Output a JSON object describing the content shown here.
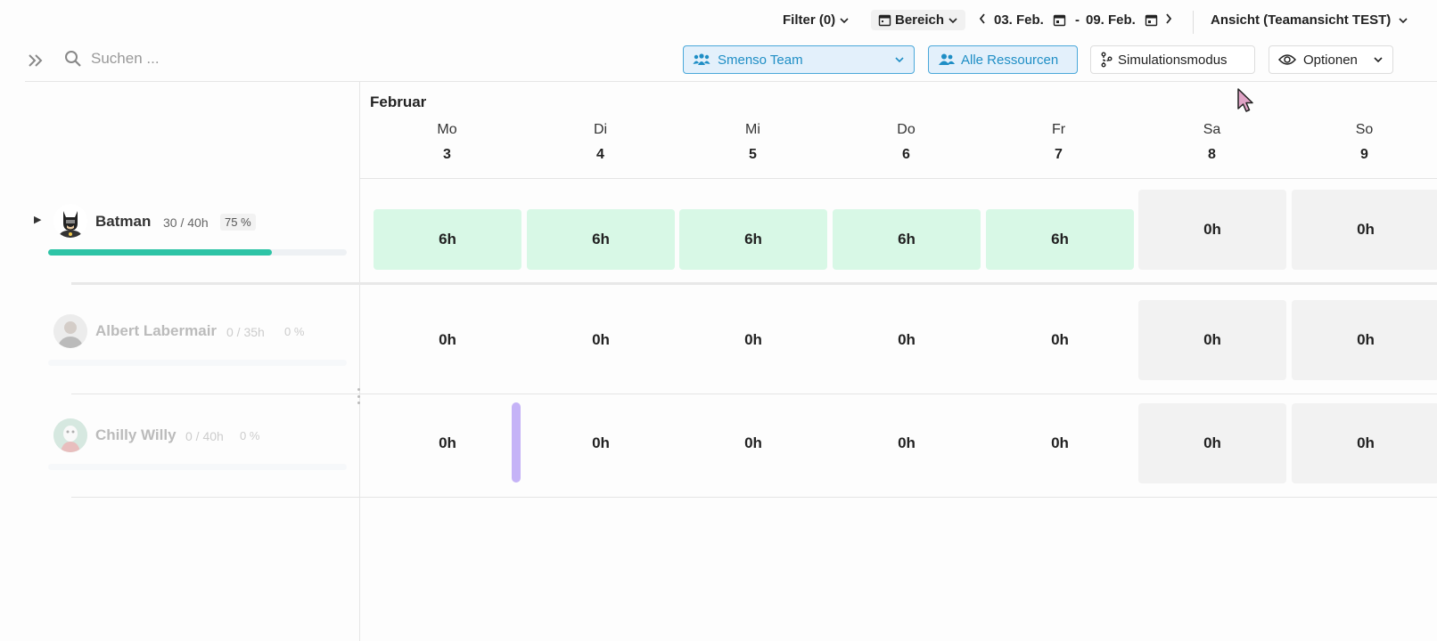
{
  "topbar": {
    "filter_label": "Filter (0)",
    "range_label": "Bereich",
    "date_from": "03. Feb.",
    "date_sep": "-",
    "date_to": "09. Feb.",
    "view_prefix": "Ansicht (",
    "view_name": "Teamansicht TEST",
    "view_suffix": ")"
  },
  "toolbar": {
    "search_placeholder": "Suchen ...",
    "team_select_value": "Smenso Team",
    "all_resources_label": "Alle Ressourcen",
    "simulation_label": "Simulationsmodus",
    "options_label": "Optionen"
  },
  "calendar": {
    "month": "Februar",
    "days": [
      {
        "name": "Mo",
        "date": "3"
      },
      {
        "name": "Di",
        "date": "4"
      },
      {
        "name": "Mi",
        "date": "5"
      },
      {
        "name": "Do",
        "date": "6"
      },
      {
        "name": "Fr",
        "date": "7"
      },
      {
        "name": "Sa",
        "date": "8"
      },
      {
        "name": "So",
        "date": "9"
      }
    ]
  },
  "resources": [
    {
      "name": "Batman",
      "hours": "30 / 40h",
      "percent": "75 %",
      "utilization": 0.75,
      "cells": [
        "6h",
        "6h",
        "6h",
        "6h",
        "6h",
        "0h",
        "0h"
      ]
    },
    {
      "name": "Albert Labermair",
      "hours": "0 / 35h",
      "percent": "0 %",
      "utilization": 0,
      "cells": [
        "0h",
        "0h",
        "0h",
        "0h",
        "0h",
        "0h",
        "0h"
      ]
    },
    {
      "name": "Chilly Willy",
      "hours": "0 / 40h",
      "percent": "0 %",
      "utilization": 0,
      "cells": [
        "0h",
        "0h",
        "0h",
        "0h",
        "0h",
        "0h",
        "0h"
      ]
    }
  ],
  "colors": {
    "accent_blue": "#1f8ec5",
    "work_cell": "#d8f8e6",
    "weekend_cell": "#f2f2f2",
    "progress": "#2ec4a6",
    "drag_handle": "#c5b3f7"
  }
}
